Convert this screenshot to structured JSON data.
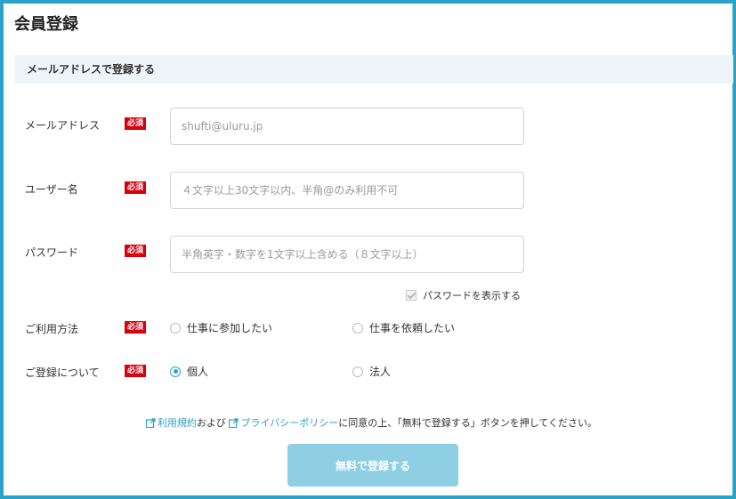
{
  "page": {
    "title": "会員登録"
  },
  "section": {
    "title": "メールアドレスで登録する"
  },
  "required_badge": "必須",
  "email": {
    "label": "メールアドレス",
    "placeholder": "shufti@uluru.jp"
  },
  "username": {
    "label": "ユーザー名",
    "placeholder": "４文字以上30文字以内、半角@のみ利用不可"
  },
  "password": {
    "label": "パスワード",
    "placeholder": "半角英字・数字を1文字以上含める（８文字以上）",
    "show_label": "パスワードを表示する"
  },
  "usage": {
    "label": "ご利用方法",
    "options": [
      "仕事に参加したい",
      "仕事を依頼したい"
    ],
    "selected": null
  },
  "registration_type": {
    "label": "ご登録について",
    "options": [
      "個人",
      "法人"
    ],
    "selected": "個人"
  },
  "terms": {
    "link1": "利用規約",
    "and": "および",
    "link2": "プライバシーポリシー",
    "suffix": "に同意の上、「無料で登録する」ボタンを押してください。"
  },
  "submit": {
    "label": "無料で登録する"
  },
  "colors": {
    "accent": "#2aa3c7",
    "required": "#d7000f",
    "button": "#8fcfe3",
    "section_bg": "#edf5fa"
  }
}
